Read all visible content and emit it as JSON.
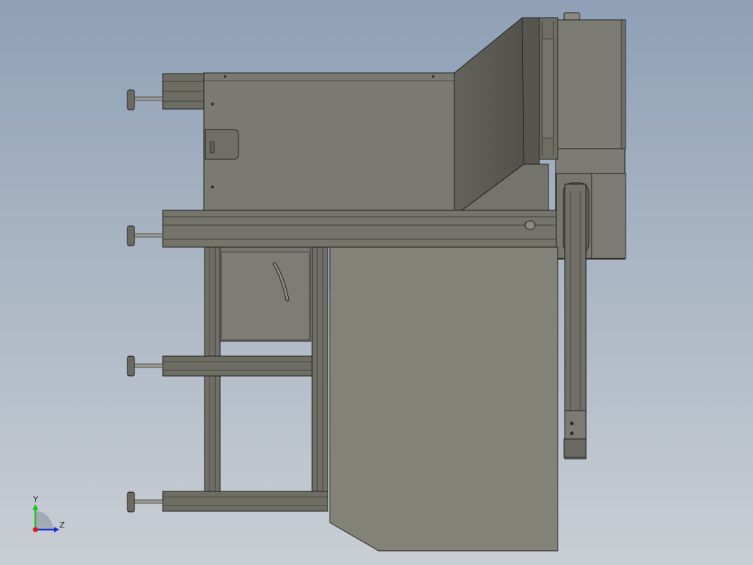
{
  "viewport": {
    "background_top": "#8fa0b6",
    "background_bottom": "#c9ced4"
  },
  "colors": {
    "body_light": "#808077",
    "body_mid": "#777770",
    "body_dark": "#5a5a52",
    "edge": "#1f1f1c",
    "rail": "#6d6d64"
  },
  "triad": {
    "y_label": "Y",
    "z_label": "Z",
    "y_color": "#18c018",
    "z_color": "#1a2fd4",
    "origin_color": "#e01818"
  }
}
